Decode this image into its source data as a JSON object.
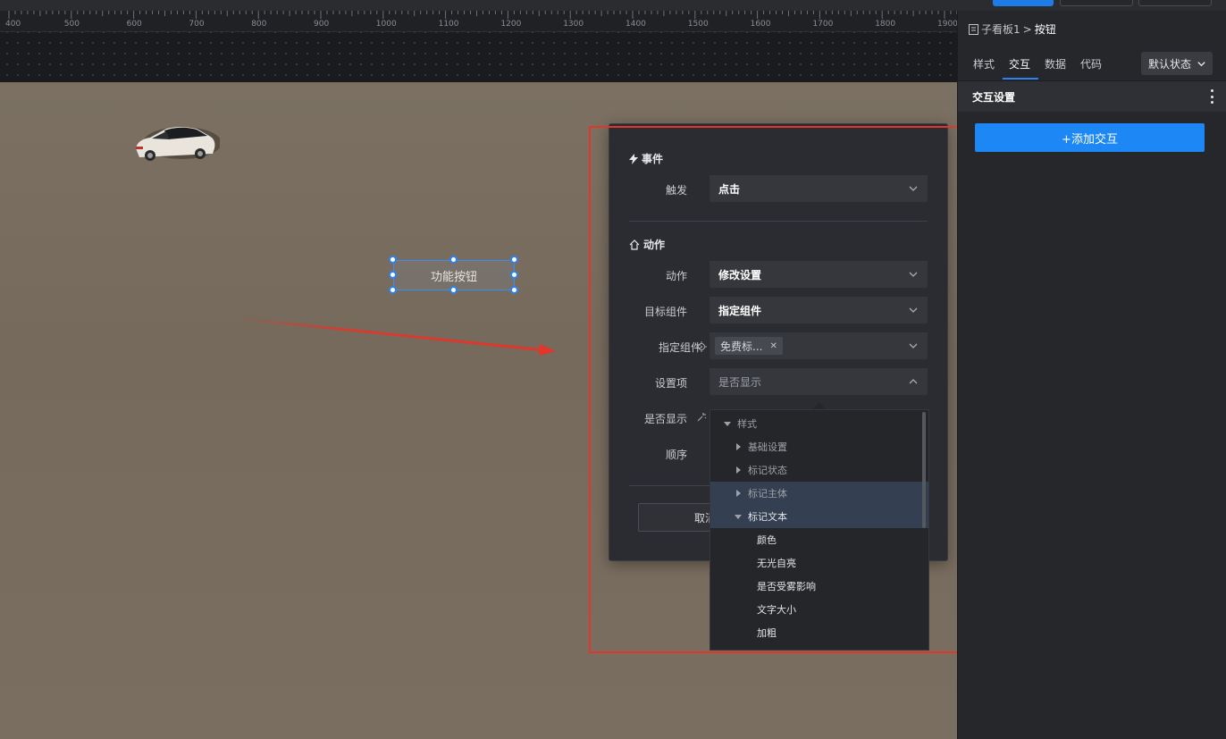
{
  "ruler": {
    "labels": [
      "400",
      "500",
      "600",
      "700",
      "800",
      "900",
      "1000",
      "1100",
      "1200",
      "1300",
      "1400",
      "1500",
      "1600",
      "1700",
      "1800",
      "1900"
    ]
  },
  "canvas": {
    "button_label": "功能按钮"
  },
  "modal": {
    "event_section": "事件",
    "trigger_label": "触发",
    "trigger_value": "点击",
    "action_section": "动作",
    "action_label": "动作",
    "action_value": "修改设置",
    "target_label": "目标组件",
    "target_value": "指定组件",
    "specify_label": "指定组件",
    "specify_tag": "免费标...",
    "setting_label": "设置项",
    "setting_placeholder": "是否显示",
    "visible_label": "是否显示",
    "order_label": "顺序",
    "cancel_label": "取消"
  },
  "dropdown": {
    "items": [
      {
        "label": "样式",
        "level": 0,
        "expanded": true
      },
      {
        "label": "基础设置",
        "level": 1,
        "expanded": false
      },
      {
        "label": "标记状态",
        "level": 1,
        "expanded": false
      },
      {
        "label": "标记主体",
        "level": 1,
        "expanded": false
      },
      {
        "label": "标记文本",
        "level": 1,
        "expanded": true
      },
      {
        "label": "颜色",
        "level": 2
      },
      {
        "label": "无光自亮",
        "level": 2
      },
      {
        "label": "是否受雾影响",
        "level": 2
      },
      {
        "label": "文字大小",
        "level": 2
      },
      {
        "label": "加粗",
        "level": 2
      }
    ]
  },
  "panel": {
    "breadcrumb_parent": "子看板1",
    "breadcrumb_sep": ">",
    "breadcrumb_current": "按钮",
    "tabs": [
      "样式",
      "交互",
      "数据",
      "代码"
    ],
    "active_tab": "交互",
    "state_select": "默认状态",
    "section_title": "交互设置",
    "add_button": "+添加交互"
  },
  "colors": {
    "accent": "#1d87f5",
    "highlight_red": "#e3352a",
    "canvas_bg": "#7b7062"
  }
}
